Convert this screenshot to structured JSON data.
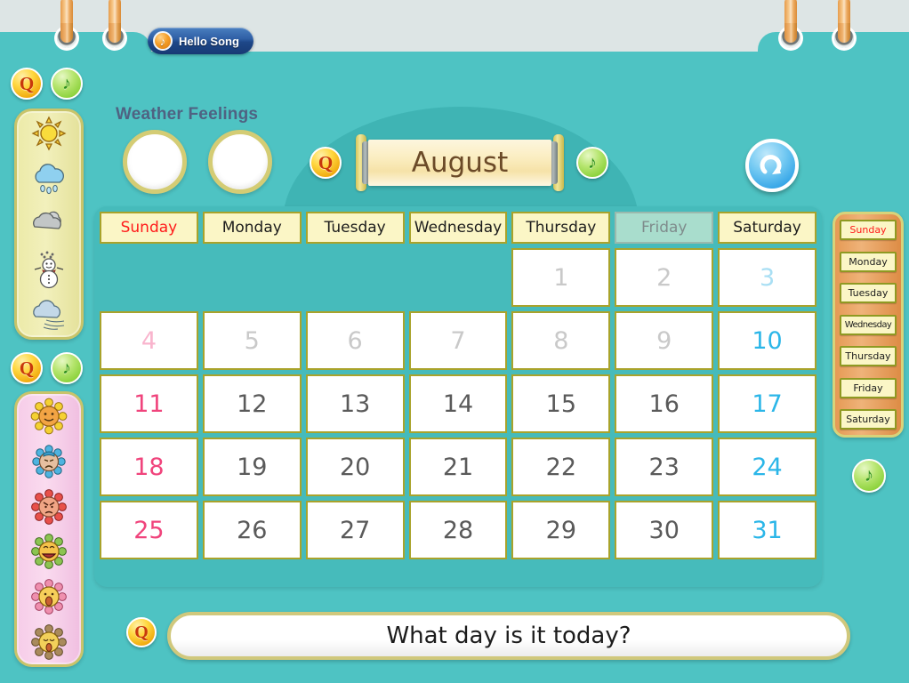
{
  "tab": {
    "label": "Hello Song",
    "icon": "music-note-icon"
  },
  "toolbar": {
    "q_label": "Q",
    "music_label": "♪"
  },
  "weather_feelings": {
    "label": "Weather Feelings",
    "weather_word": "Weather",
    "feelings_word": "Feelings",
    "weather_slot_value": "",
    "feelings_slot_value": ""
  },
  "weather_panel": {
    "items": [
      {
        "name": "sun-icon",
        "label": "Sunny"
      },
      {
        "name": "rain-cloud-icon",
        "label": "Rainy"
      },
      {
        "name": "cloudy-icon",
        "label": "Cloudy"
      },
      {
        "name": "snowman-icon",
        "label": "Snowy"
      },
      {
        "name": "windy-cloud-icon",
        "label": "Windy"
      }
    ]
  },
  "feelings_panel": {
    "items": [
      {
        "name": "flower-happy-icon",
        "label": "Happy",
        "color": "#f5d132"
      },
      {
        "name": "flower-sad-icon",
        "label": "Sad",
        "color": "#4eb3e0"
      },
      {
        "name": "flower-angry-icon",
        "label": "Angry",
        "color": "#e8504a"
      },
      {
        "name": "flower-excited-icon",
        "label": "Excited",
        "color": "#8cc451"
      },
      {
        "name": "flower-surprised-icon",
        "label": "Surprised",
        "color": "#ef8fae"
      },
      {
        "name": "flower-sleepy-icon",
        "label": "Sleepy",
        "color": "#a98a5c"
      }
    ]
  },
  "month": {
    "name": "August"
  },
  "refresh": {
    "name": "refresh-icon"
  },
  "calendar": {
    "day_headers": [
      {
        "label": "Sunday",
        "style": "sunday"
      },
      {
        "label": "Monday",
        "style": ""
      },
      {
        "label": "Tuesday",
        "style": ""
      },
      {
        "label": "Wednesday",
        "style": ""
      },
      {
        "label": "Thursday",
        "style": ""
      },
      {
        "label": "Friday",
        "style": "inactive"
      },
      {
        "label": "Saturday",
        "style": ""
      }
    ],
    "leading_blanks": 4,
    "weeks": [
      [
        {
          "d": ""
        },
        {
          "d": ""
        },
        {
          "d": ""
        },
        {
          "d": ""
        },
        {
          "d": "1",
          "style": "past"
        },
        {
          "d": "2",
          "style": "past"
        },
        {
          "d": "3",
          "style": "sat past"
        }
      ],
      [
        {
          "d": "4",
          "style": "sun past"
        },
        {
          "d": "5",
          "style": "past"
        },
        {
          "d": "6",
          "style": "past"
        },
        {
          "d": "7",
          "style": "past"
        },
        {
          "d": "8",
          "style": "past"
        },
        {
          "d": "9",
          "style": "past"
        },
        {
          "d": "10",
          "style": "sat"
        }
      ],
      [
        {
          "d": "11",
          "style": "sun"
        },
        {
          "d": "12"
        },
        {
          "d": "13"
        },
        {
          "d": "14"
        },
        {
          "d": "15"
        },
        {
          "d": "16"
        },
        {
          "d": "17",
          "style": "sat"
        }
      ],
      [
        {
          "d": "18",
          "style": "sun"
        },
        {
          "d": "19"
        },
        {
          "d": "20"
        },
        {
          "d": "21"
        },
        {
          "d": "22"
        },
        {
          "d": "23"
        },
        {
          "d": "24",
          "style": "sat"
        }
      ],
      [
        {
          "d": "25",
          "style": "sun"
        },
        {
          "d": "26"
        },
        {
          "d": "27"
        },
        {
          "d": "28"
        },
        {
          "d": "29"
        },
        {
          "d": "30"
        },
        {
          "d": "31",
          "style": "sat"
        }
      ]
    ]
  },
  "day_list": {
    "items": [
      {
        "label": "Sunday",
        "style": "sunday"
      },
      {
        "label": "Monday",
        "style": ""
      },
      {
        "label": "Tuesday",
        "style": ""
      },
      {
        "label": "Wednesday",
        "style": "squeeze"
      },
      {
        "label": "Thursday",
        "style": ""
      },
      {
        "label": "Friday",
        "style": ""
      },
      {
        "label": "Saturday",
        "style": ""
      }
    ]
  },
  "question": {
    "text": "What day is it today?",
    "q_label": "Q",
    "icon": "question-badge-icon"
  },
  "colors": {
    "background_teal": "#4ec3c3",
    "panel_teal": "#46bbbb",
    "dome_teal": "#3fb4b4",
    "cell_border_olive": "#a9a32b",
    "header_cream": "#fbf6c6",
    "sunday_red": "#ff1a1a",
    "sunday_date_pink": "#f0447c",
    "saturday_blue": "#2bb6e8",
    "weekday_gray": "#5a5a5a",
    "past_gray": "#c9c9c9",
    "gold_ring": "#d4cc74",
    "daylist_orange": "#e59a55",
    "label_slate": "#4f6282"
  }
}
